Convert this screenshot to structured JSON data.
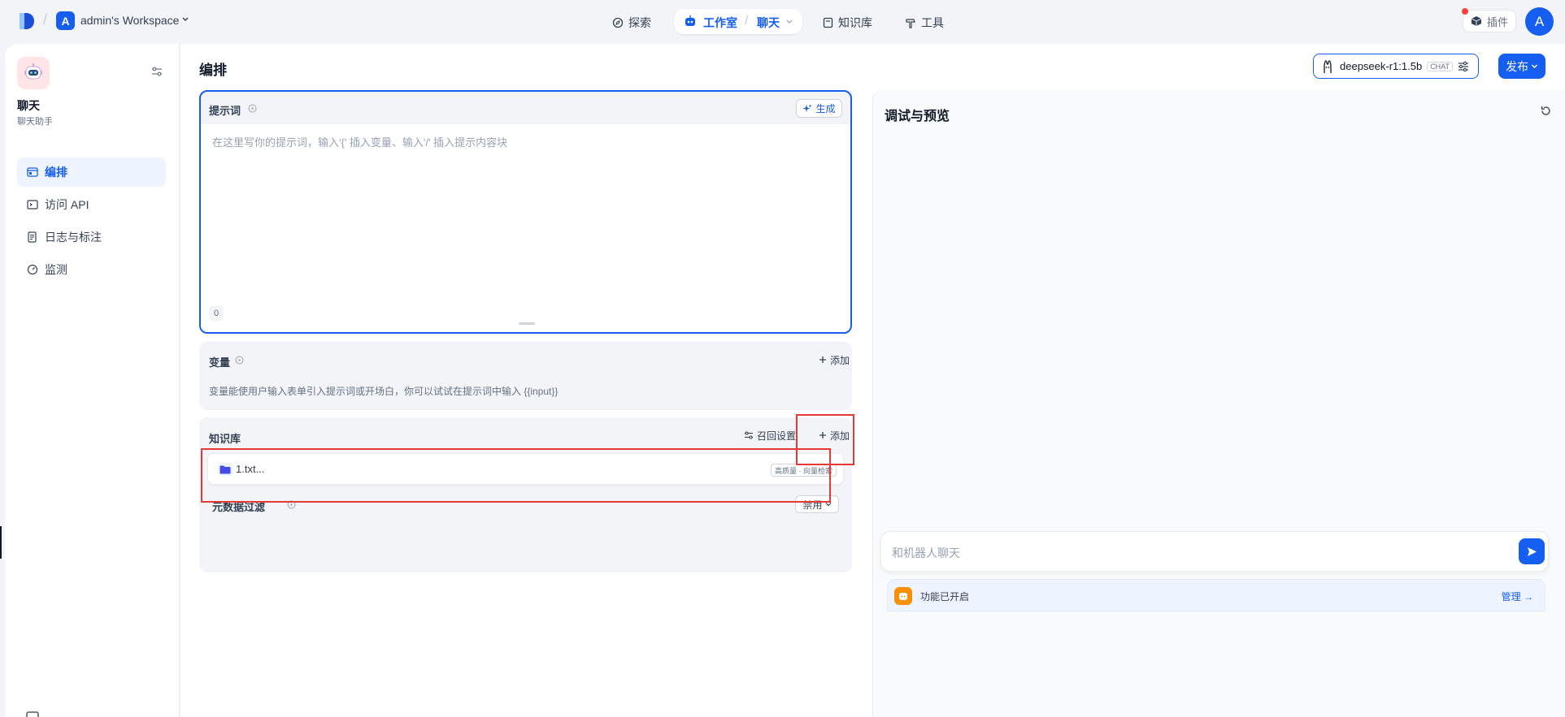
{
  "workspace": {
    "avatar": "A",
    "name": "admin's Workspace"
  },
  "nav": {
    "explore": "探索",
    "studio": "工作室",
    "current_app": "聊天",
    "knowledge": "知识库",
    "tools": "工具"
  },
  "header_right": {
    "plugins": "插件",
    "user_avatar": "A"
  },
  "app": {
    "name": "聊天",
    "subtitle": "聊天助手"
  },
  "sidebar": {
    "items": [
      {
        "label": "编排",
        "icon": "layout-icon",
        "active": true
      },
      {
        "label": "访问 API",
        "icon": "terminal-icon",
        "active": false
      },
      {
        "label": "日志与标注",
        "icon": "log-icon",
        "active": false
      },
      {
        "label": "监测",
        "icon": "gauge-icon",
        "active": false
      }
    ]
  },
  "main": {
    "title": "编排",
    "model": {
      "name": "deepseek-r1:1.5b",
      "badge": "CHAT"
    },
    "publish": "发布"
  },
  "prompt": {
    "label": "提示词",
    "generate": "生成",
    "placeholder": "在这里写你的提示词，输入'{' 插入变量、输入'/' 插入提示内容块",
    "count": "0"
  },
  "variables": {
    "label": "变量",
    "add": "添加",
    "description": "变量能使用户输入表单引入提示词或开场白，你可以试试在提示词中输入 {{input}}"
  },
  "knowledge": {
    "label": "知识库",
    "recall_settings": "召回设置",
    "add": "添加",
    "items": [
      {
        "name": "1.txt...",
        "tag": "高质量 · 向量检索"
      }
    ],
    "metadata_filter": "元数据过滤",
    "metadata_value": "禁用"
  },
  "preview": {
    "title": "调试与预览",
    "input_placeholder": "和机器人聊天",
    "feature_text": "功能已开启",
    "manage": "管理 →"
  },
  "colors": {
    "accent": "#155eef",
    "highlight": "#e53935"
  }
}
